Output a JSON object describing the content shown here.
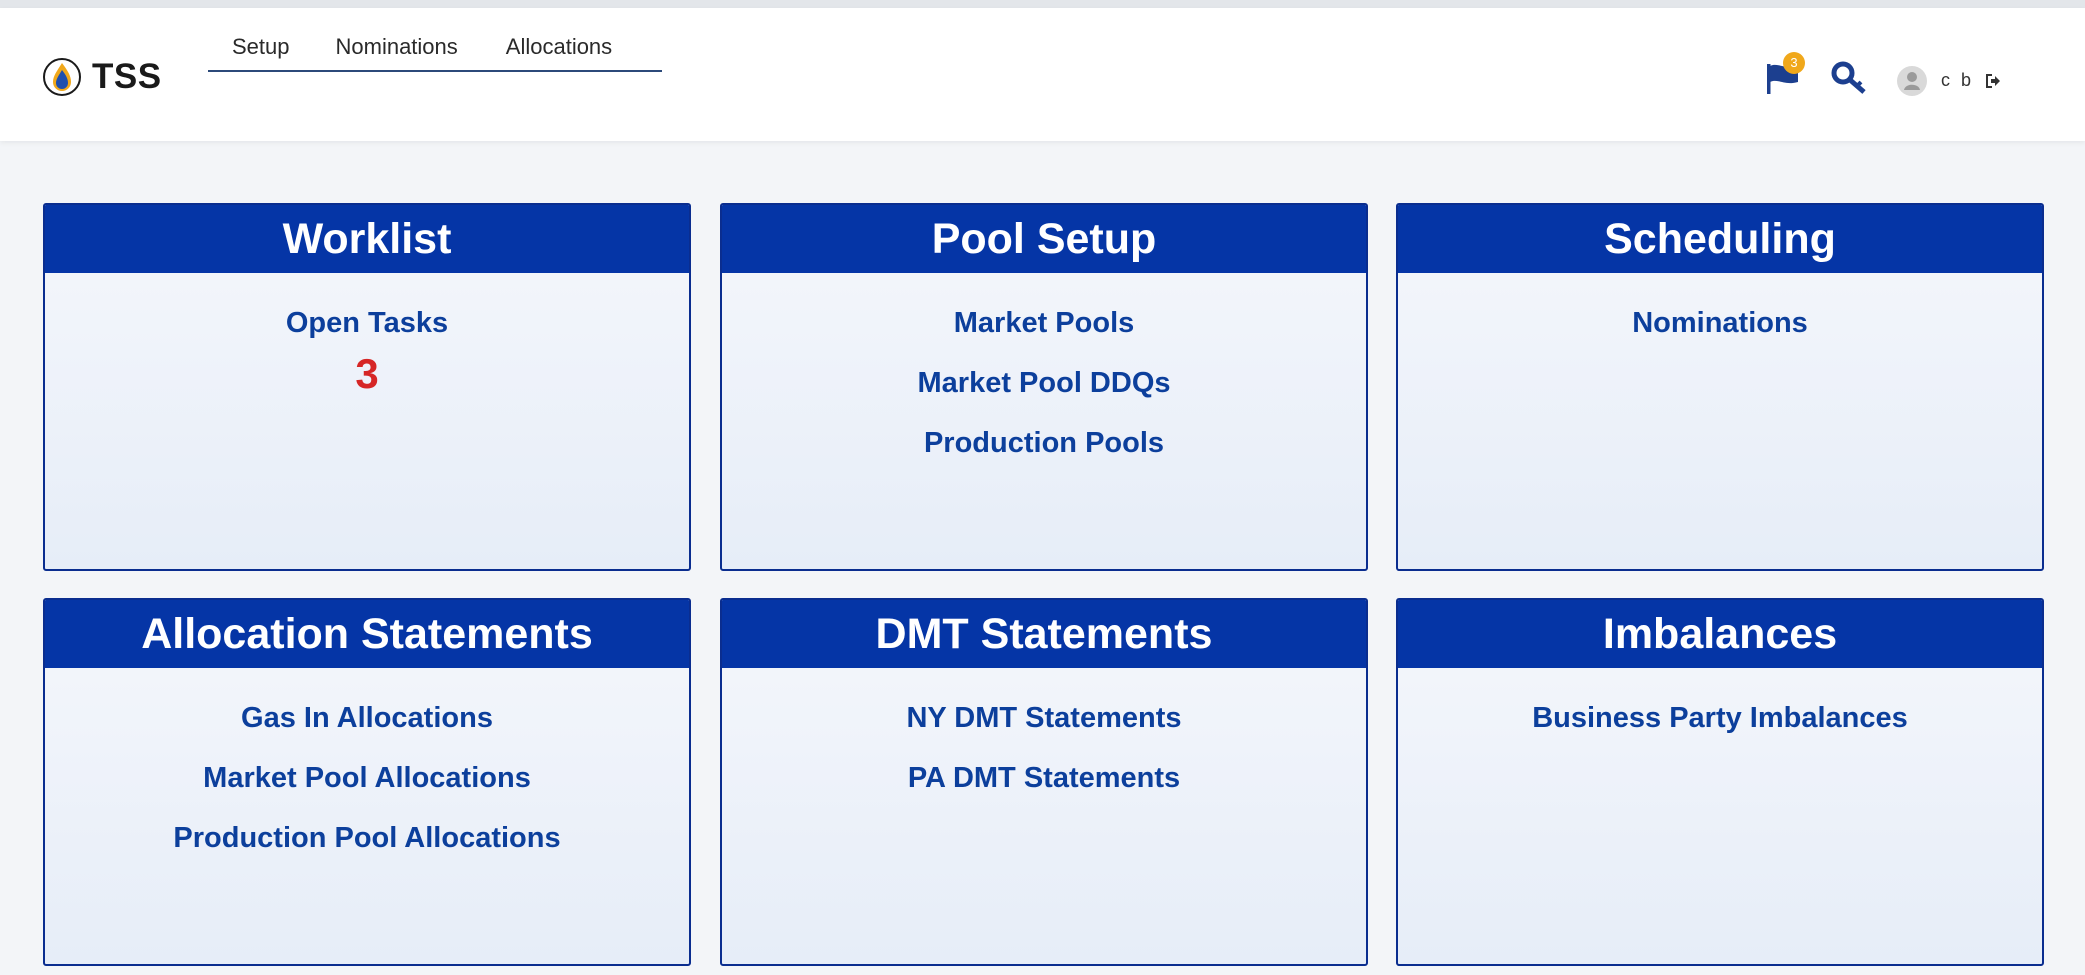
{
  "app": {
    "name": "TSS"
  },
  "nav": {
    "items": [
      "Setup",
      "Nominations",
      "Allocations"
    ]
  },
  "header": {
    "notification_count": "3",
    "user_initials": "c b",
    "icons": [
      "flag-icon",
      "key-icon",
      "user-avatar-icon",
      "logout-icon"
    ]
  },
  "colors": {
    "card_header": "#0535a6",
    "card_border": "#0a2d8f",
    "link": "#0c3f9c",
    "count": "#d62626",
    "badge": "#f0a81b"
  },
  "cards": [
    {
      "title": "Worklist",
      "links": [
        "Open Tasks"
      ],
      "count": "3"
    },
    {
      "title": "Pool Setup",
      "links": [
        "Market Pools",
        "Market Pool DDQs",
        "Production Pools"
      ]
    },
    {
      "title": "Scheduling",
      "links": [
        "Nominations"
      ]
    },
    {
      "title": "Allocation Statements",
      "links": [
        "Gas In Allocations",
        "Market Pool Allocations",
        "Production Pool Allocations"
      ]
    },
    {
      "title": "DMT Statements",
      "links": [
        "NY DMT Statements",
        "PA DMT Statements"
      ]
    },
    {
      "title": "Imbalances",
      "links": [
        "Business Party Imbalances"
      ]
    }
  ]
}
